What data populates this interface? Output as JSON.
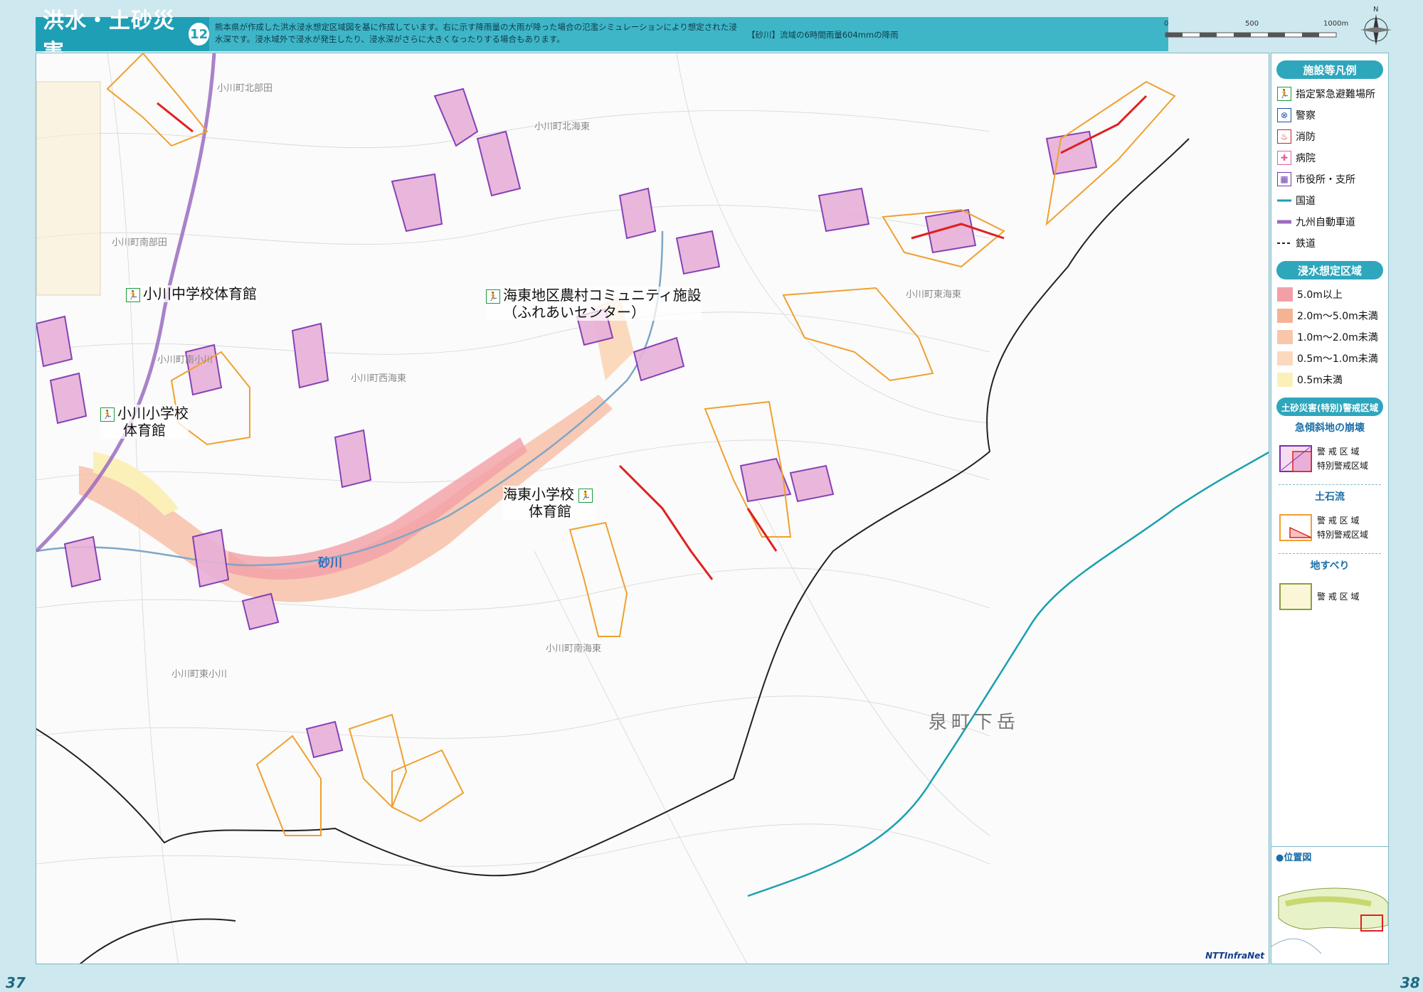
{
  "header": {
    "title": "洪水・土砂災害",
    "number": "12",
    "description": "熊本県が作成した洪水浸水想定区域図を基に作成しています。右に示す降雨量の大雨が降った場合の氾濫シミュレーションにより想定された浸水深です。浸水域外で浸水が発生したり、浸水深がさらに大きくなったりする場合もあります。",
    "note": "【砂川】流域の6時間雨量604mmの降雨"
  },
  "scale": {
    "labels": [
      "0",
      "500",
      "1000m"
    ]
  },
  "north": {
    "label": "N"
  },
  "map": {
    "place_labels": [
      {
        "text": "小川町北部田"
      },
      {
        "text": "小川町北海東"
      },
      {
        "text": "小川町南部田"
      },
      {
        "text": "小川町東海東"
      },
      {
        "text": "小川町南小川"
      },
      {
        "text": "小川町西海東"
      },
      {
        "text": "小川町南海東"
      },
      {
        "text": "小川町東小川"
      }
    ],
    "big_place": "泉町下岳",
    "river": "砂川",
    "facilities": [
      {
        "label": "小川中学校体育館"
      },
      {
        "label": "海東地区農村コミュニティ施設",
        "sub": "（ふれあいセンター）"
      },
      {
        "label": "小川小学校",
        "sub": "体育館"
      },
      {
        "label": "海東小学校",
        "sub": "体育館"
      }
    ],
    "logo": "NTTInfraNet"
  },
  "legend": {
    "facilities_head": "施設等凡例",
    "facility_items": [
      {
        "label": "指定緊急避難場所",
        "icon": "evacuation-icon",
        "glyph": "🏃"
      },
      {
        "label": "警察",
        "icon": "police-icon",
        "glyph": "⊗"
      },
      {
        "label": "消防",
        "icon": "fire-station-icon",
        "glyph": "♨"
      },
      {
        "label": "病院",
        "icon": "hospital-icon",
        "glyph": "✚"
      },
      {
        "label": "市役所・支所",
        "icon": "city-office-icon",
        "glyph": "▦"
      },
      {
        "label": "国道",
        "icon": "national-road-line",
        "glyph": ""
      },
      {
        "label": "九州自動車道",
        "icon": "expressway-line",
        "glyph": ""
      },
      {
        "label": "鉄道",
        "icon": "railway-line",
        "glyph": ""
      }
    ],
    "flood_head": "浸水想定区域",
    "flood_items": [
      {
        "label": "5.0m以上",
        "color": "#f2a0a6"
      },
      {
        "label": "2.0m～5.0m未満",
        "color": "#f5b394"
      },
      {
        "label": "1.0m～2.0m未満",
        "color": "#f8c7aa"
      },
      {
        "label": "0.5m～1.0m未満",
        "color": "#fbd9bc"
      },
      {
        "label": "0.5m未満",
        "color": "#fbf0b8"
      }
    ],
    "sediment_head": "土砂災害(特別)警戒区域",
    "sediment_groups": [
      {
        "title": "急傾斜地の崩壊",
        "lines": [
          "警 戒 区 域",
          "特別警戒区域"
        ]
      },
      {
        "title": "土石流",
        "lines": [
          "警 戒 区 域",
          "特別警戒区域"
        ]
      },
      {
        "title": "地すべり",
        "lines": [
          "警 戒 区 域"
        ]
      }
    ]
  },
  "inset": {
    "title": "●位置図"
  },
  "pages": {
    "left": "37",
    "right": "38"
  },
  "colors": {
    "accent": "#1f9fb5",
    "steep_slope": "#7a2fb0",
    "debris_flow": "#f0a030",
    "special_zone": "#e02020",
    "national_road": "#1aa0b0",
    "expressway": "#9a6cc0",
    "boundary": "#222222"
  }
}
